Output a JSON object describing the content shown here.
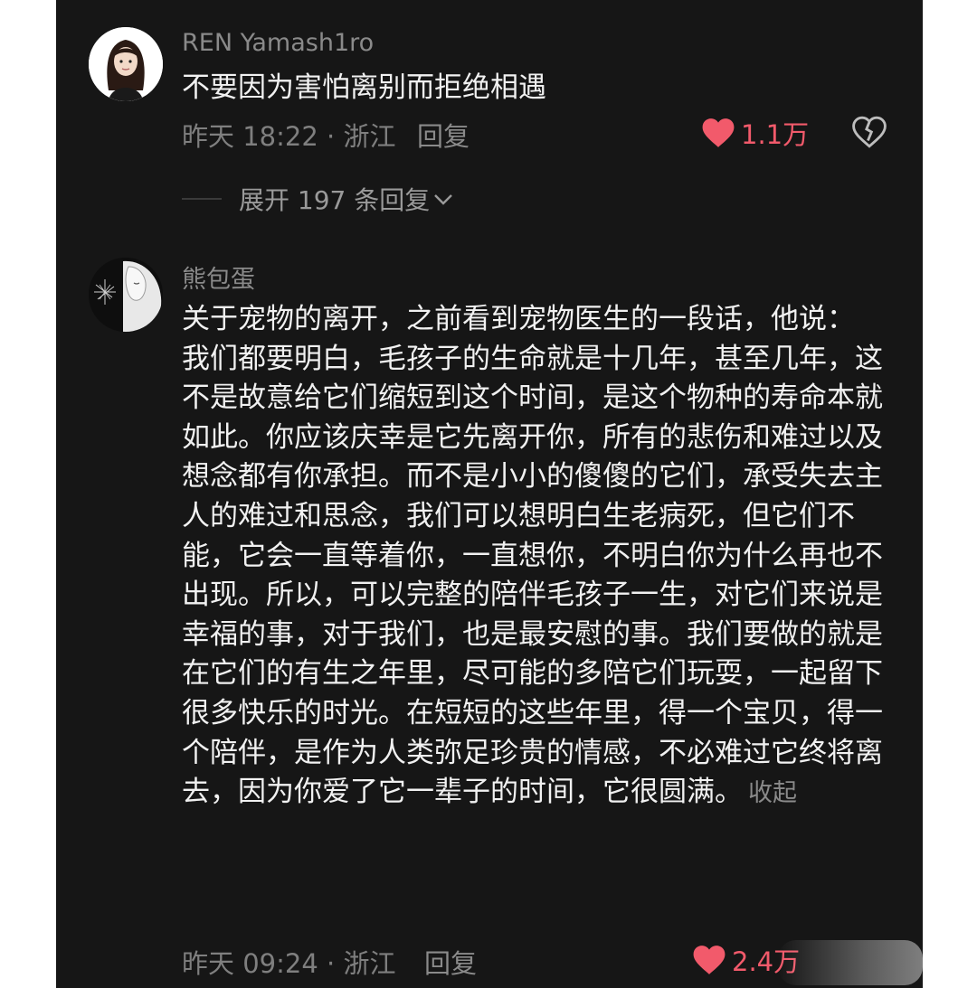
{
  "comments": [
    {
      "username": "REN Yamash1ro",
      "content": "不要因为害怕离别而拒绝相遇",
      "meta": "昨天 18:22 · 浙江",
      "reply_label": "回复",
      "like_count": "1.1万",
      "liked": true,
      "avatar_icon": "girl-dark-hair-avatar",
      "replies_expand_label": "展开 197 条回复"
    },
    {
      "username": "熊包蛋",
      "content": "关于宠物的离开，之前看到宠物医生的一段话，他说：\n我们都要明白，毛孩子的生命就是十几年，甚至几年，这不是故意给它们缩短到这个时间，是这个物种的寿命本就如此。你应该庆幸是它先离开你，所有的悲伤和难过以及想念都有你承担。而不是小小的傻傻的它们，承受失去主人的难过和思念，我们可以想明白生老病死，但它们不能，它会一直等着你，一直想你，不明白你为什么再也不出现。所以，可以完整的陪伴毛孩子一生，对它们来说是幸福的事，对于我们，也是最安慰的事。我们要做的就是在它们的有生之年里，尽可能的多陪它们玩耍，一起留下很多快乐的时光。在短短的这些年里，得一个宝贝，得一个陪伴，是作为人类弥足珍贵的情感，不必难过它终将离去，因为你爱了它一辈子的时间，它很圆满。",
      "collapse_label": "收起",
      "meta": "昨天 09:24 · 浙江",
      "reply_label": "回复",
      "like_count": "2.4万",
      "liked": true,
      "avatar_icon": "sketch-girl-avatar"
    }
  ],
  "colors": {
    "background": "#161616",
    "like_red": "#f25a6b",
    "text_primary": "#f1f1f1",
    "text_secondary": "#8a8a8a"
  }
}
